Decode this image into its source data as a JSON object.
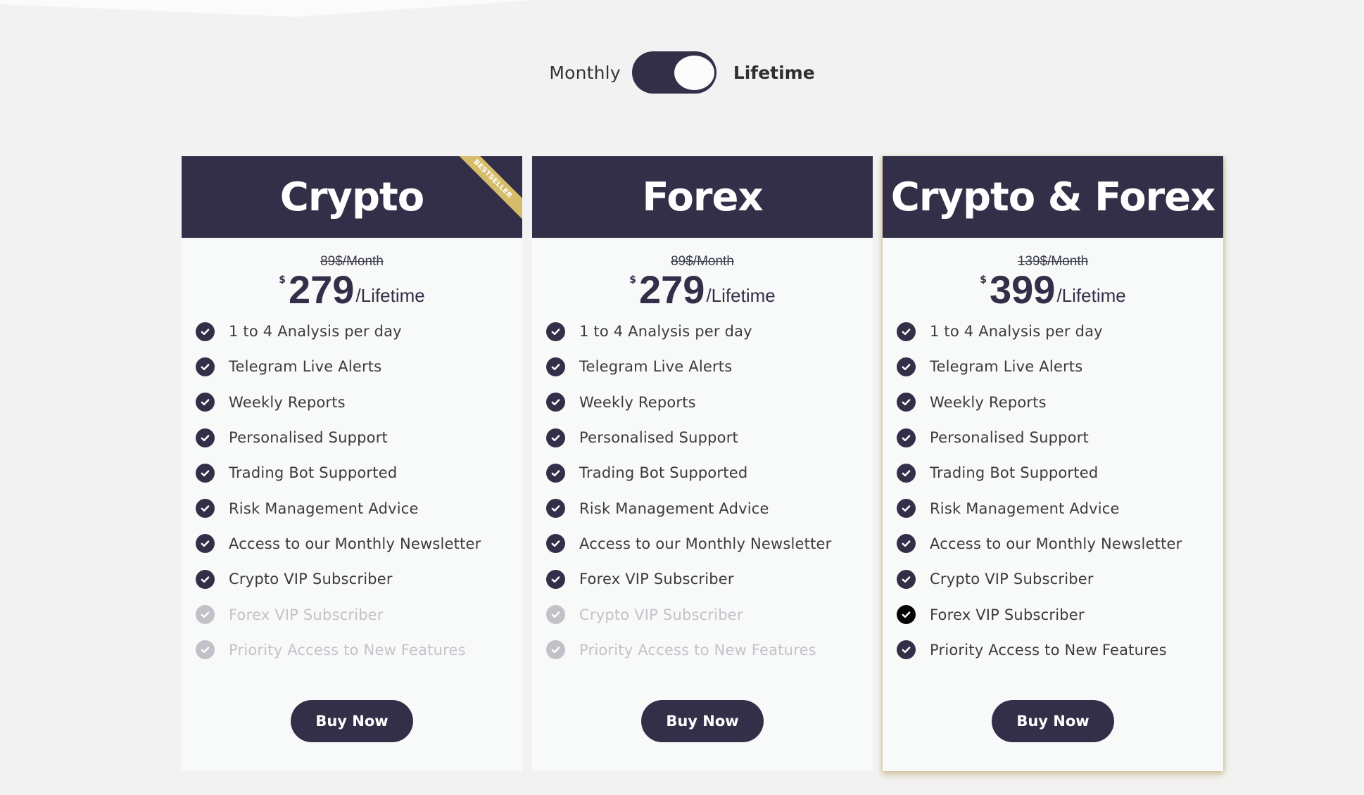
{
  "billing_toggle": {
    "monthly_label": "Monthly",
    "lifetime_label": "Lifetime",
    "selected": "Lifetime"
  },
  "colors": {
    "brand_navy": "#342f48",
    "ribbon_gold": "#d5bd6b",
    "background": "#f2f2f2",
    "disabled_text": "#c3c2c9"
  },
  "plans": [
    {
      "title": "Crypto",
      "ribbon": "BESTSELLER",
      "old_price": "89$/Month",
      "currency": "$",
      "amount": "279",
      "period": "/Lifetime",
      "button_label": "Buy Now",
      "features": [
        {
          "label": "1 to 4 Analysis per day",
          "included": true
        },
        {
          "label": "Telegram Live Alerts",
          "included": true
        },
        {
          "label": "Weekly Reports",
          "included": true
        },
        {
          "label": "Personalised Support",
          "included": true
        },
        {
          "label": "Trading Bot Supported",
          "included": true
        },
        {
          "label": "Risk Management Advice",
          "included": true
        },
        {
          "label": "Access to our Monthly Newsletter",
          "included": true
        },
        {
          "label": "Crypto VIP Subscriber",
          "included": true
        },
        {
          "label": "Forex VIP Subscriber",
          "included": false
        },
        {
          "label": "Priority Access to New Features",
          "included": false
        }
      ]
    },
    {
      "title": "Forex",
      "old_price": "89$/Month",
      "currency": "$",
      "amount": "279",
      "period": "/Lifetime",
      "button_label": "Buy Now",
      "features": [
        {
          "label": "1 to 4 Analysis per day",
          "included": true
        },
        {
          "label": "Telegram Live Alerts",
          "included": true
        },
        {
          "label": "Weekly Reports",
          "included": true
        },
        {
          "label": "Personalised Support",
          "included": true
        },
        {
          "label": "Trading Bot Supported",
          "included": true
        },
        {
          "label": "Risk Management Advice",
          "included": true
        },
        {
          "label": "Access to our Monthly Newsletter",
          "included": true
        },
        {
          "label": "Forex VIP Subscriber",
          "included": true
        },
        {
          "label": "Crypto VIP Subscriber",
          "included": false
        },
        {
          "label": "Priority Access to New Features",
          "included": false
        }
      ]
    },
    {
      "title": "Crypto & Forex",
      "old_price": "139$/Month",
      "currency": "$",
      "amount": "399",
      "period": "/Lifetime",
      "button_label": "Buy Now",
      "features": [
        {
          "label": "1 to 4 Analysis per day",
          "included": true
        },
        {
          "label": "Telegram Live Alerts",
          "included": true
        },
        {
          "label": "Weekly Reports",
          "included": true
        },
        {
          "label": "Personalised Support",
          "included": true
        },
        {
          "label": "Trading Bot Supported",
          "included": true
        },
        {
          "label": "Risk Management Advice",
          "included": true
        },
        {
          "label": "Access to our Monthly Newsletter",
          "included": true
        },
        {
          "label": "Crypto VIP Subscriber",
          "included": true
        },
        {
          "label": "Forex VIP Subscriber",
          "included": true
        },
        {
          "label": "Priority Access to New Features",
          "included": true
        }
      ]
    }
  ]
}
